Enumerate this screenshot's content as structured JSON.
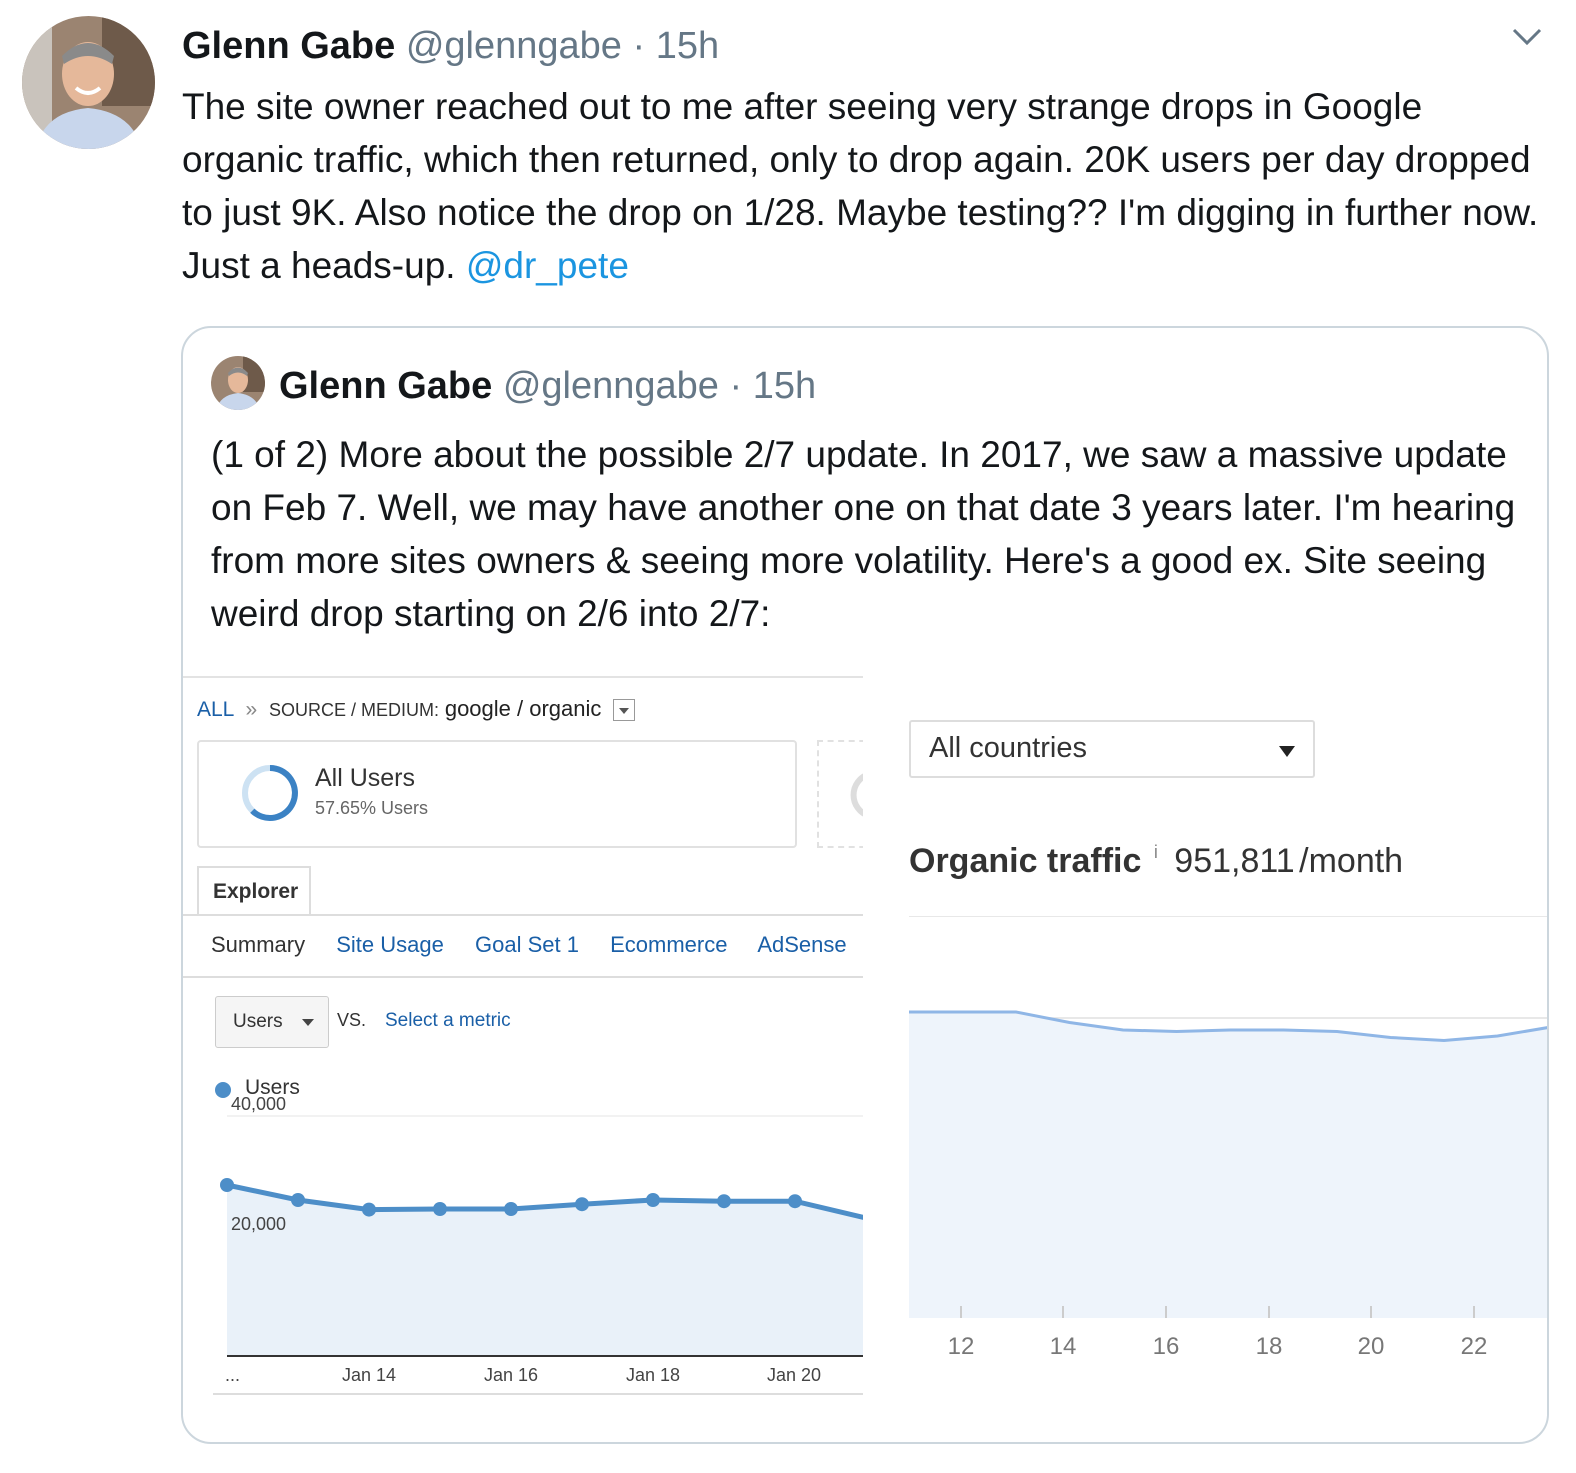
{
  "tweet": {
    "name": "Glenn Gabe",
    "handle": "@glenngabe",
    "separator": "·",
    "time": "15h",
    "text": "The site owner reached out to me after seeing very strange drops in Google organic traffic, which then returned, only to drop again. 20K users per day dropped to just 9K. Also notice the drop on 1/28. Maybe testing?? I'm digging in further now. Just a heads-up.",
    "mention": "@dr_pete"
  },
  "quote": {
    "name": "Glenn Gabe",
    "handle": "@glenngabe",
    "separator": "·",
    "time": "15h",
    "text": "(1 of 2) More about the possible 2/7 update. In 2017, we saw a massive update on Feb 7. Well, we may have another one on that date 3 years later. I'm hearing from more sites owners & seeing more volatility. Here's a good ex. Site seeing weird drop starting on 2/6 into 2/7:"
  },
  "analytics": {
    "breadcrumb_all": "ALL",
    "breadcrumb_sep": "»",
    "breadcrumb_source": "SOURCE / MEDIUM:",
    "breadcrumb_value": "google / organic",
    "segment_title": "All Users",
    "segment_sub": "57.65% Users",
    "tab_explorer": "Explorer",
    "subtabs": [
      "Summary",
      "Site Usage",
      "Goal Set 1",
      "Ecommerce",
      "AdSense"
    ],
    "metric": "Users",
    "vs": "VS.",
    "select_metric": "Select a metric",
    "legend": "Users",
    "colors": {
      "line": "#4d8ec8",
      "fill": "#e9f1f9",
      "link": "#1a5fa7"
    }
  },
  "ahrefs": {
    "country": "All countries",
    "label": "Organic traffic",
    "info": "i",
    "value": "951,811",
    "unit": "/month",
    "colors": {
      "line": "#8fb6e6",
      "fill": "#eef4fb"
    }
  },
  "chart_data": [
    {
      "type": "area",
      "x_tick_labels": [
        "...",
        "Jan 14",
        "Jan 16",
        "Jan 18",
        "Jan 20"
      ],
      "y_tick_labels": [
        "40,000",
        "20,000"
      ],
      "ylim": [
        0,
        40000
      ],
      "series": [
        {
          "name": "Users",
          "values": [
            28500,
            26000,
            24400,
            24500,
            24500,
            25300,
            26000,
            25800,
            25800,
            23000
          ]
        }
      ]
    },
    {
      "type": "area",
      "x_tick_labels": [
        "12",
        "14",
        "16",
        "18",
        "20",
        "22"
      ],
      "series": [
        {
          "values": [
            1.0,
            1.0,
            1.0,
            0.93,
            0.88,
            0.87,
            0.88,
            0.88,
            0.87,
            0.83,
            0.81,
            0.84,
            0.9
          ]
        }
      ]
    }
  ]
}
